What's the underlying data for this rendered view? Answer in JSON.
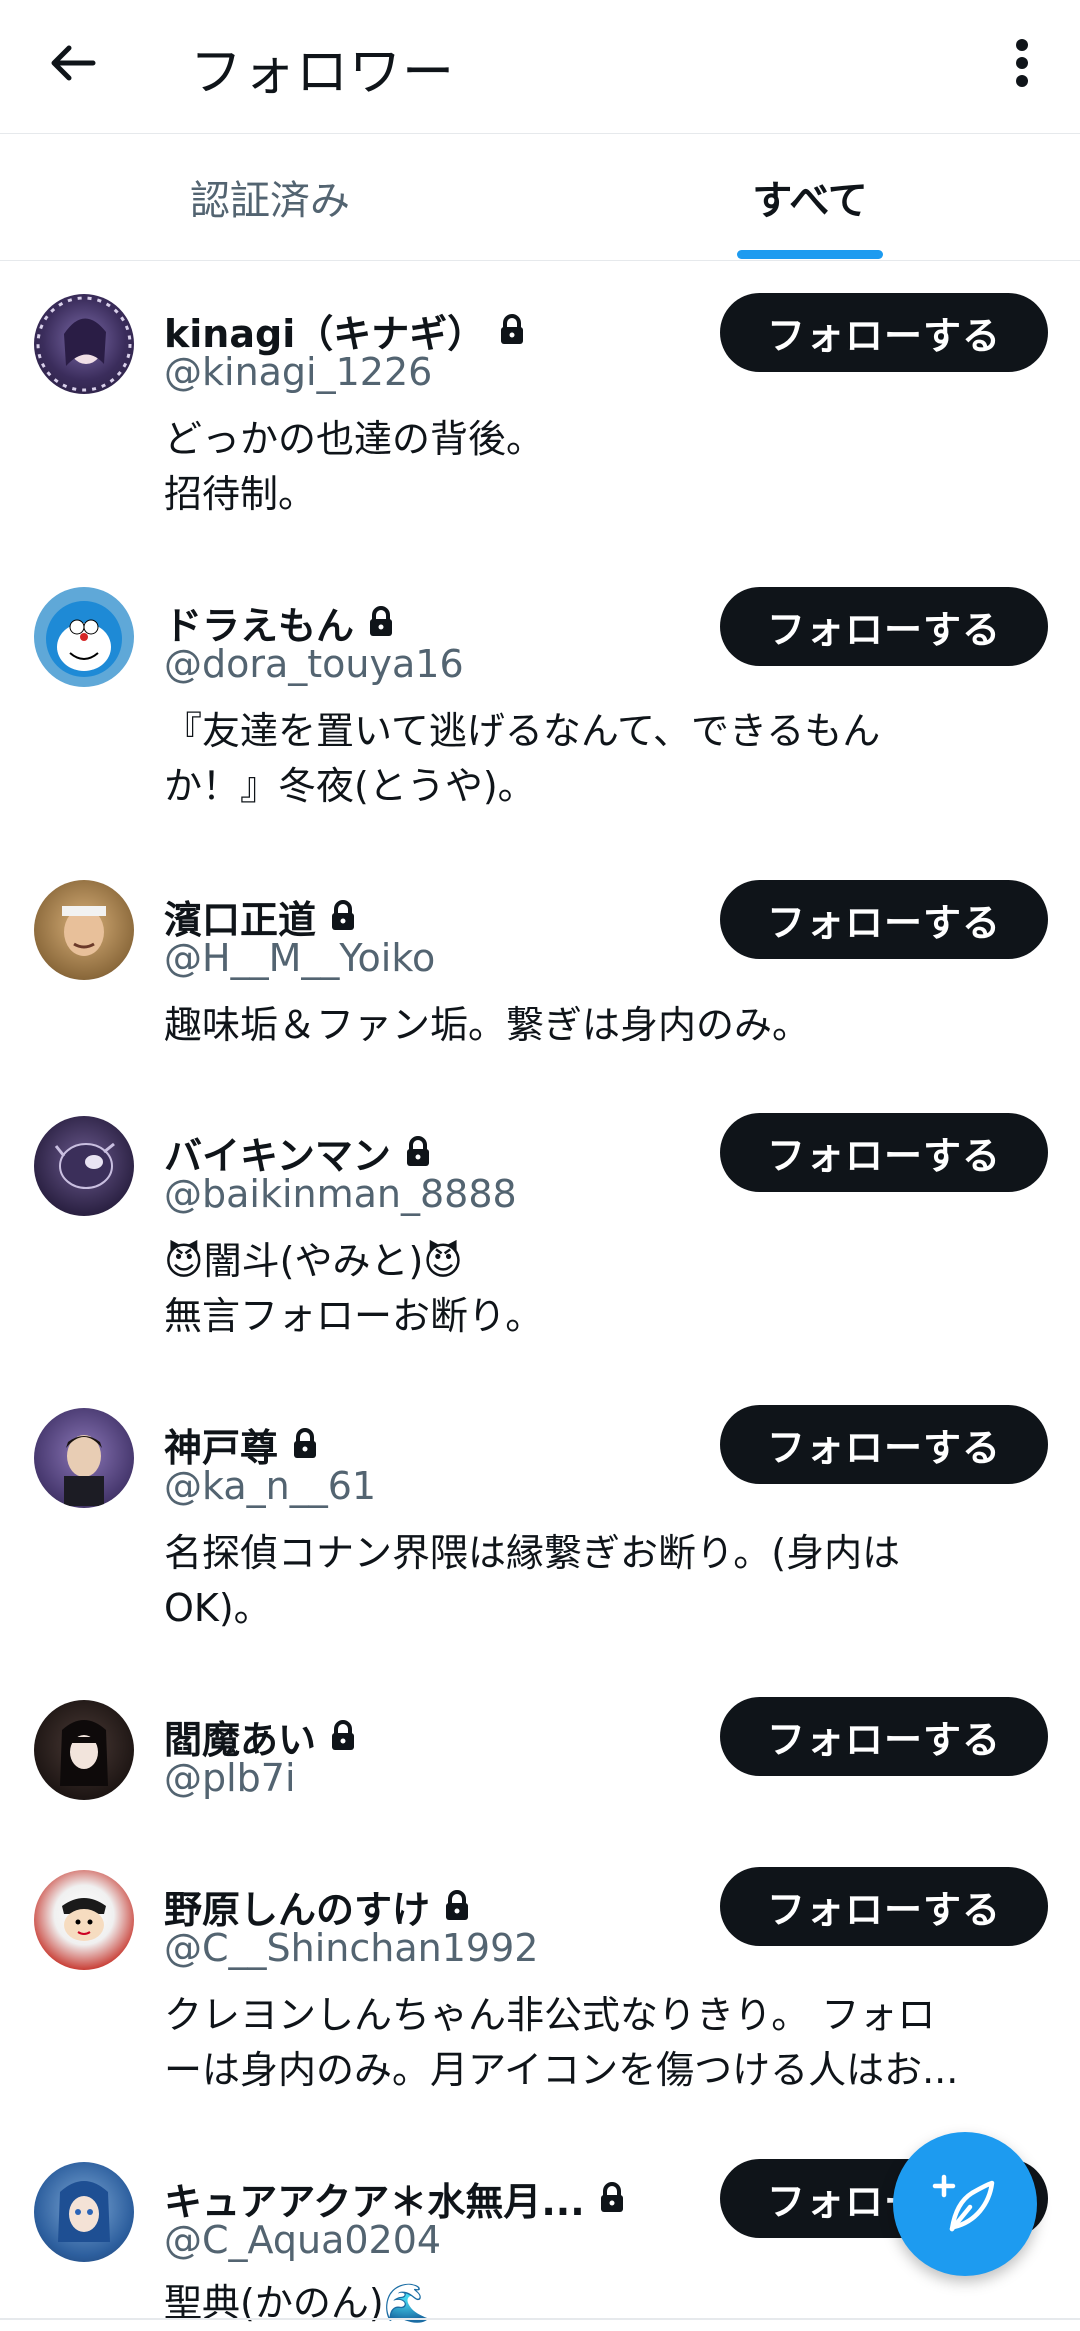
{
  "header": {
    "title": "フォロワー"
  },
  "tabs": [
    {
      "label": "認証済み",
      "active": false
    },
    {
      "label": "すべて",
      "active": true
    }
  ],
  "follow_label": "フォローする",
  "accent_color": "#1d9bf0",
  "users": [
    {
      "name": "kinagi（キナギ）",
      "handle": "@kinagi_1226",
      "bio": [
        "どっかの也達の背後。",
        "招待制。"
      ],
      "locked": true
    },
    {
      "name": "ドラえもん",
      "handle": "@dora_touya16",
      "bio": [
        "『友達を置いて逃げるなんて、できるもん",
        "か！』冬夜(とうや)。"
      ],
      "locked": true
    },
    {
      "name": "濱口正道",
      "handle": "@H__M__Yoiko",
      "bio": [
        "趣味垢＆ファン垢。繋ぎは身内のみ。"
      ],
      "locked": true
    },
    {
      "name": "バイキンマン",
      "handle": "@baikinman_8888",
      "bio": [
        "😈闇斗(やみと)😈",
        "無言フォローお断り。"
      ],
      "locked": true
    },
    {
      "name": "神戸尊",
      "handle": "@ka_n__61",
      "bio": [
        "名探偵コナン界隈は縁繋ぎお断り。(身内は",
        "OK)。"
      ],
      "locked": true
    },
    {
      "name": "閻魔あい",
      "handle": "@plb7i",
      "bio": [],
      "locked": true
    },
    {
      "name": "野原しんのすけ",
      "handle": "@C__Shinchan1992",
      "bio": [
        "クレヨンしんちゃん非公式なりきり。 フォロ",
        "ーは身内のみ。月アイコンを傷つける人はお..."
      ],
      "locked": true
    },
    {
      "name": "キュアアクア＊水無月...",
      "handle": "@C_Aqua0204",
      "bio": [
        "聖典(かのん)🌊"
      ],
      "locked": true
    }
  ]
}
